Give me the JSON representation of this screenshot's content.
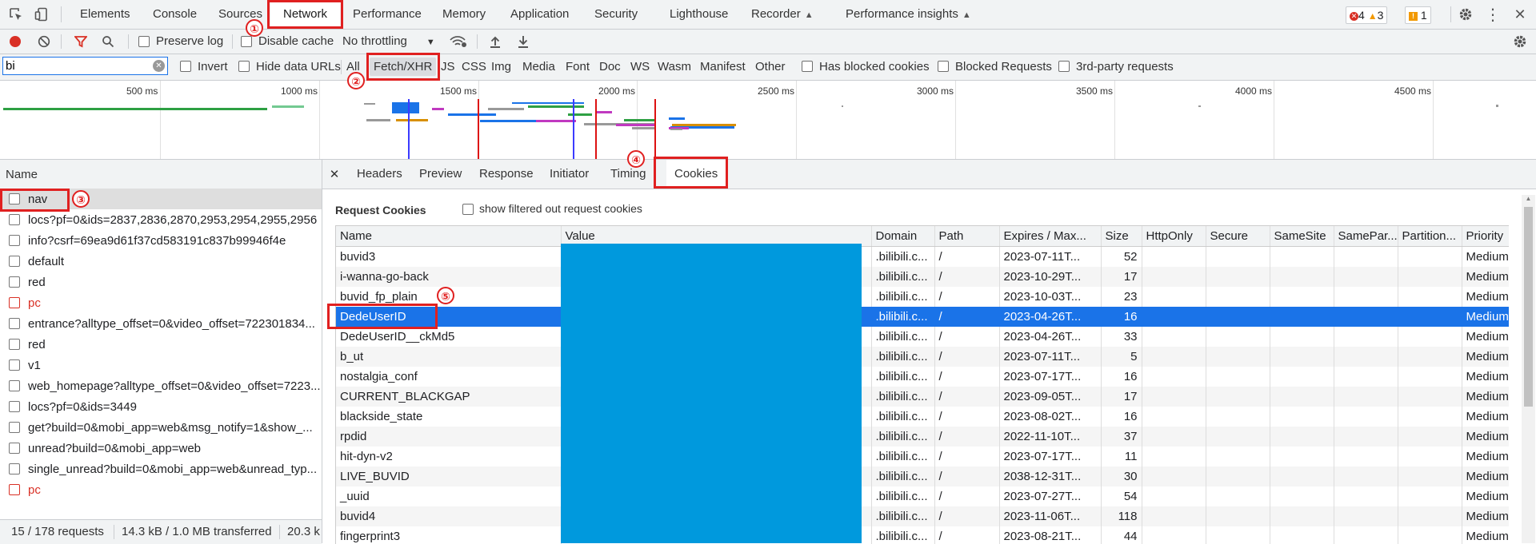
{
  "tabs": [
    {
      "label": "Elements"
    },
    {
      "label": "Console"
    },
    {
      "label": "Sources"
    },
    {
      "label": "Network"
    },
    {
      "label": "Performance"
    },
    {
      "label": "Memory"
    },
    {
      "label": "Application"
    },
    {
      "label": "Security"
    },
    {
      "label": "Lighthouse"
    },
    {
      "label": "Recorder"
    },
    {
      "label": "Performance insights"
    }
  ],
  "status": {
    "errors": "4",
    "warnings": "3",
    "issues": "1"
  },
  "toolbar": {
    "preserve_log": "Preserve log",
    "disable_cache": "Disable cache",
    "throttling": "No throttling"
  },
  "filter": {
    "value": "bi",
    "invert": "Invert",
    "hide_data_urls": "Hide data URLs",
    "types": [
      "All",
      "Fetch/XHR",
      "JS",
      "CSS",
      "Img",
      "Media",
      "Font",
      "Doc",
      "WS",
      "Wasm",
      "Manifest",
      "Other"
    ],
    "blocked_cookies": "Has blocked cookies",
    "blocked_requests": "Blocked Requests",
    "third_party": "3rd-party requests"
  },
  "timeline": {
    "ticks": [
      "500 ms",
      "1000 ms",
      "1500 ms",
      "2000 ms",
      "2500 ms",
      "3000 ms",
      "3500 ms",
      "4000 ms",
      "4500 ms"
    ]
  },
  "requests": {
    "header": "Name",
    "items": [
      {
        "name": "nav"
      },
      {
        "name": "locs?pf=0&ids=2837,2836,2870,2953,2954,2955,2956"
      },
      {
        "name": "info?csrf=69ea9d61f37cd583191c837b99946f4e"
      },
      {
        "name": "default"
      },
      {
        "name": "red"
      },
      {
        "name": "pc"
      },
      {
        "name": "entrance?alltype_offset=0&video_offset=722301834..."
      },
      {
        "name": "red"
      },
      {
        "name": "v1"
      },
      {
        "name": "web_homepage?alltype_offset=0&video_offset=7223..."
      },
      {
        "name": "locs?pf=0&ids=3449"
      },
      {
        "name": "get?build=0&mobi_app=web&msg_notify=1&show_..."
      },
      {
        "name": "unread?build=0&mobi_app=web"
      },
      {
        "name": "single_unread?build=0&mobi_app=web&unread_typ..."
      },
      {
        "name": "pc"
      }
    ],
    "footer": {
      "count": "15 / 178 requests",
      "transferred": "14.3 kB / 1.0 MB transferred",
      "resources": "20.3 k"
    }
  },
  "detail_tabs": [
    "Headers",
    "Preview",
    "Response",
    "Initiator",
    "Timing",
    "Cookies"
  ],
  "cookies": {
    "section_title": "Request Cookies",
    "show_filtered": "show filtered out request cookies",
    "columns": [
      "Name",
      "Value",
      "Domain",
      "Path",
      "Expires / Max...",
      "Size",
      "HttpOnly",
      "Secure",
      "SameSite",
      "SamePar...",
      "Partition...",
      "Priority"
    ],
    "rows": [
      {
        "name": "buvid3",
        "domain": ".bilibili.c...",
        "path": "/",
        "expires": "2023-07-11T...",
        "size": "52",
        "priority": "Medium"
      },
      {
        "name": "i-wanna-go-back",
        "domain": ".bilibili.c...",
        "path": "/",
        "expires": "2023-10-29T...",
        "size": "17",
        "priority": "Medium"
      },
      {
        "name": "buvid_fp_plain",
        "domain": ".bilibili.c...",
        "path": "/",
        "expires": "2023-10-03T...",
        "size": "23",
        "priority": "Medium"
      },
      {
        "name": "DedeUserID",
        "domain": ".bilibili.c...",
        "path": "/",
        "expires": "2023-04-26T...",
        "size": "16",
        "priority": "Medium"
      },
      {
        "name": "DedeUserID__ckMd5",
        "domain": ".bilibili.c...",
        "path": "/",
        "expires": "2023-04-26T...",
        "size": "33",
        "priority": "Medium"
      },
      {
        "name": "b_ut",
        "domain": ".bilibili.c...",
        "path": "/",
        "expires": "2023-07-11T...",
        "size": "5",
        "priority": "Medium"
      },
      {
        "name": "nostalgia_conf",
        "domain": ".bilibili.c...",
        "path": "/",
        "expires": "2023-07-17T...",
        "size": "16",
        "priority": "Medium"
      },
      {
        "name": "CURRENT_BLACKGAP",
        "domain": ".bilibili.c...",
        "path": "/",
        "expires": "2023-09-05T...",
        "size": "17",
        "priority": "Medium"
      },
      {
        "name": "blackside_state",
        "domain": ".bilibili.c...",
        "path": "/",
        "expires": "2023-08-02T...",
        "size": "16",
        "priority": "Medium"
      },
      {
        "name": "rpdid",
        "domain": ".bilibili.c...",
        "path": "/",
        "expires": "2022-11-10T...",
        "size": "37",
        "priority": "Medium"
      },
      {
        "name": "hit-dyn-v2",
        "domain": ".bilibili.c...",
        "path": "/",
        "expires": "2023-07-17T...",
        "size": "11",
        "priority": "Medium"
      },
      {
        "name": "LIVE_BUVID",
        "domain": ".bilibili.c...",
        "path": "/",
        "expires": "2038-12-31T...",
        "size": "30",
        "priority": "Medium"
      },
      {
        "name": "_uuid",
        "domain": ".bilibili.c...",
        "path": "/",
        "expires": "2023-07-27T...",
        "size": "54",
        "priority": "Medium"
      },
      {
        "name": "buvid4",
        "domain": ".bilibili.c...",
        "path": "/",
        "expires": "2023-11-06T...",
        "size": "118",
        "priority": "Medium"
      },
      {
        "name": "fingerprint3",
        "domain": ".bilibili.c...",
        "path": "/",
        "expires": "2023-08-21T...",
        "size": "44",
        "priority": "Medium"
      }
    ]
  },
  "annotations": [
    "①",
    "②",
    "③",
    "④",
    "⑤"
  ],
  "colors": {
    "annotation": "#e02020",
    "selection": "#1a73e8",
    "redaction": "#0099dd",
    "record": "#d93025"
  }
}
